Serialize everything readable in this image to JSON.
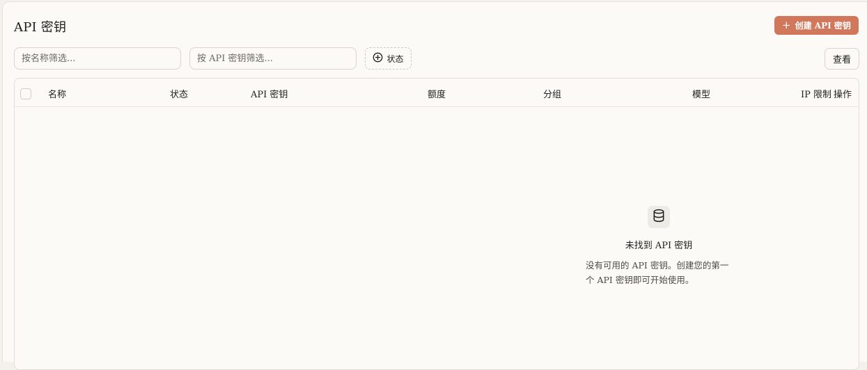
{
  "header": {
    "title": "API 密钥",
    "create_button_label": "创建 API 密钥"
  },
  "filters": {
    "name_placeholder": "按名称筛选...",
    "key_placeholder": "按 API 密钥筛选...",
    "status_label": "状态",
    "view_label": "查看"
  },
  "table": {
    "columns": [
      "名称",
      "状态",
      "API 密钥",
      "额度",
      "分组",
      "模型",
      "IP 限制",
      "操作"
    ]
  },
  "empty_state": {
    "title": "未找到 API 密钥",
    "description": "没有可用的 API 密钥。创建您的第一个 API 密钥即可开始使用。"
  },
  "colors": {
    "accent": "#d0775c",
    "background": "#fbfaf7"
  }
}
